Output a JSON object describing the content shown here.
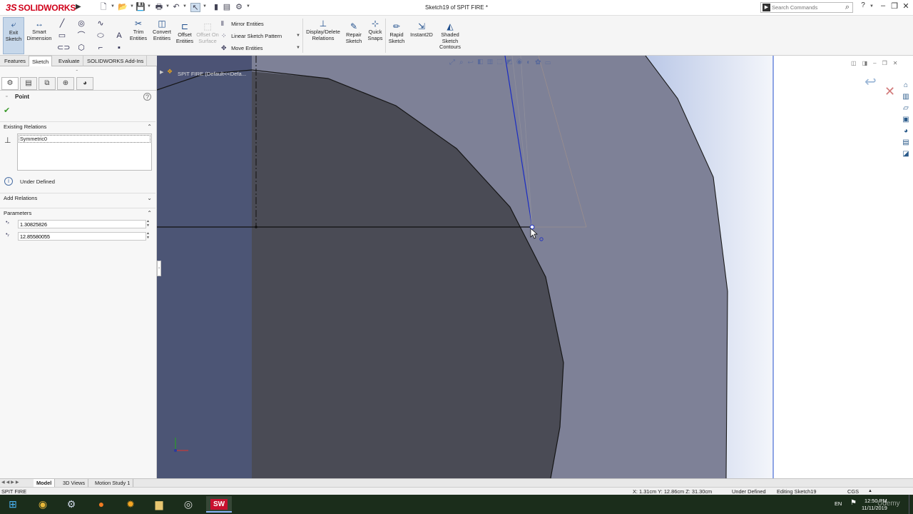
{
  "app": {
    "logo_text": "SOLIDWORKS",
    "logo_prefix": "3S",
    "doc_title": "Sketch19 of SPIT FIRE *",
    "search_placeholder": "Search Commands",
    "help": "?",
    "accent": "#d0021b"
  },
  "ribbon": {
    "exit_sketch": "Exit Sketch",
    "smart_dimension": "Smart Dimension",
    "trim_entities": "Trim Entities",
    "convert_entities": "Convert Entities",
    "offset_entities": "Offset Entities",
    "offset_on_surface": "Offset On Surface",
    "mirror_entities": "Mirror Entities",
    "linear_sketch_pattern": "Linear Sketch Pattern",
    "move_entities": "Move Entities",
    "display_delete_relations": "Display/Delete Relations",
    "repair_sketch": "Repair Sketch",
    "quick_snaps": "Quick Snaps",
    "rapid_sketch": "Rapid Sketch",
    "instant2d": "Instant2D",
    "shaded_sketch_contours": "Shaded Sketch Contours"
  },
  "tabs": [
    "Features",
    "Sketch",
    "Evaluate",
    "SOLIDWORKS Add-Ins"
  ],
  "active_tab": "Sketch",
  "property_manager": {
    "title": "Point",
    "existing_relations_label": "Existing Relations",
    "relations": [
      "Symmetric0"
    ],
    "status": "Under Defined",
    "add_relations_label": "Add Relations",
    "parameters_label": "Parameters",
    "x_value": "1.30825826",
    "y_value": "12.85580055"
  },
  "tree": {
    "root": "SPIT FIRE  (Default<<Defa..."
  },
  "model_tabs": [
    "Model",
    "3D Views",
    "Motion Study 1"
  ],
  "status_bar": {
    "doc": "SPIT FIRE",
    "coords": "X: 1.31cm Y: 12.86cm Z: 31.30cm",
    "defined": "Under Defined",
    "editing": "Editing Sketch19",
    "units": "CGS"
  },
  "taskbar": {
    "lang": "EN",
    "time": "12:50 PM",
    "date": "11/11/2019",
    "watermark": "Udemy"
  }
}
